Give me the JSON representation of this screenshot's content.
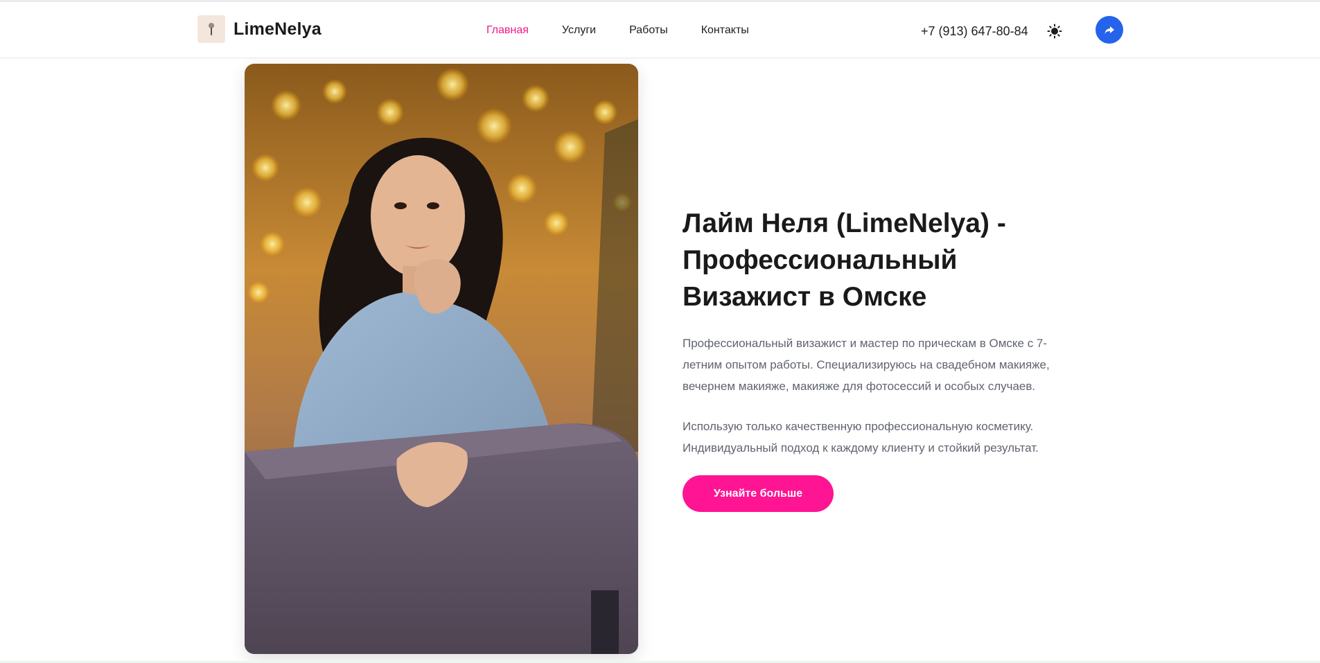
{
  "brand": {
    "name": "LimeNelya",
    "logo_icon": "makeup-brush-icon"
  },
  "nav": {
    "items": [
      {
        "label": "Главная",
        "active": true
      },
      {
        "label": "Услуги",
        "active": false
      },
      {
        "label": "Работы",
        "active": false
      },
      {
        "label": "Контакты",
        "active": false
      }
    ]
  },
  "header": {
    "phone": "+7 (913) 647-80-84",
    "theme_icon": "sun-icon",
    "share_icon": "share-arrow-icon"
  },
  "hero": {
    "photo_alt": "portrait-photo",
    "title_lines": [
      "Лайм Неля (LimeNelya) -",
      "Профессиональный",
      "Визажист в Омске"
    ],
    "description_1_lines": [
      "Профессиональный визажист и мастер по прическам в Омске с 7-",
      "летним опытом работы. Специализируюсь на свадебном макияже,",
      "вечернем макияже, макияже для фотосессий и особых случаев."
    ],
    "description_2_lines": [
      "Использую только качественную профессиональную косметику.",
      "Индивидуальный подход к каждому клиенту и стойкий результат."
    ],
    "cta_label": "Узнайте больше"
  },
  "colors": {
    "accent": "#ff1493",
    "active_nav": "#f01b86",
    "share_button": "#2563eb",
    "text_dark": "#1a1a1a",
    "text_muted": "#606470"
  }
}
